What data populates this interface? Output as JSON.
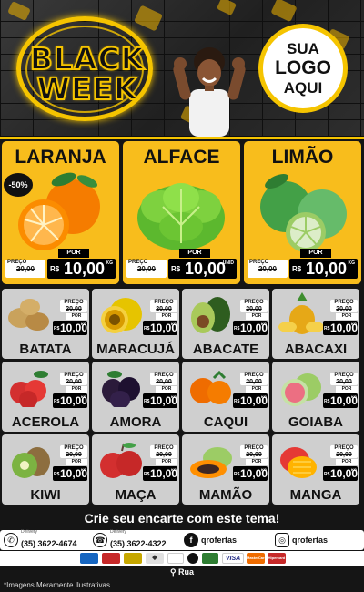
{
  "header": {
    "title": "BLACK\nWEEK",
    "logo_text": [
      "SUA",
      "LOGO",
      "AQUI"
    ]
  },
  "big_products": [
    {
      "name": "LARANJA",
      "preco_label": "PREÇO",
      "old_price": "20,00",
      "por_label": "POR",
      "currency": "R$",
      "price": "10,00",
      "unit": "KG",
      "badge": "-50%",
      "icon": "orange-icon"
    },
    {
      "name": "ALFACE",
      "preco_label": "PREÇO",
      "old_price": "20,00",
      "por_label": "POR",
      "currency": "R$",
      "price": "10,00",
      "unit": "UNID",
      "icon": "lettuce-icon"
    },
    {
      "name": "LIMÃO",
      "preco_label": "PREÇO",
      "old_price": "20,00",
      "por_label": "POR",
      "currency": "R$",
      "price": "10,00",
      "unit": "KG",
      "icon": "lime-icon"
    }
  ],
  "small_products": [
    {
      "name": "BATATA",
      "icon": "potato-icon"
    },
    {
      "name": "MARACUJÁ",
      "icon": "passion-fruit-icon"
    },
    {
      "name": "ABACATE",
      "icon": "avocado-icon"
    },
    {
      "name": "ABACAXI",
      "icon": "pineapple-icon"
    },
    {
      "name": "ACEROLA",
      "icon": "acerola-icon"
    },
    {
      "name": "AMORA",
      "icon": "blackberry-icon"
    },
    {
      "name": "CAQUI",
      "icon": "persimmon-icon"
    },
    {
      "name": "GOIABA",
      "icon": "guava-icon"
    },
    {
      "name": "KIWI",
      "icon": "kiwi-icon"
    },
    {
      "name": "MAÇA",
      "icon": "apple-icon"
    },
    {
      "name": "MAMÃO",
      "icon": "papaya-icon"
    },
    {
      "name": "MANGA",
      "icon": "mango-icon"
    }
  ],
  "small_price": {
    "preco_label": "PREÇO",
    "old_price": "20,00",
    "por_label": "POR",
    "currency": "R$",
    "price": "10,00",
    "unit": "KG"
  },
  "cta": "Crie seu encarte com este tema!",
  "contacts": [
    {
      "label": "Delivery",
      "value": "(35) 3622-4674",
      "icon": "whatsapp-icon"
    },
    {
      "label": "Delivery",
      "value": "(35) 3622-4322",
      "icon": "phone-icon"
    },
    {
      "label": "",
      "value": "qrofertas",
      "icon": "facebook-icon"
    },
    {
      "label": "",
      "value": "qrofertas",
      "icon": "instagram-icon"
    }
  ],
  "payments": [
    "VISA",
    "MasterCard",
    "Hipercard"
  ],
  "address": "Rua",
  "disclaimer": "*Imagens Meramente Ilustrativas",
  "colors": {
    "accent": "#f5c400",
    "card_big": "#f8bd1c",
    "card_small": "#cfcfcf",
    "background": "#151515"
  }
}
